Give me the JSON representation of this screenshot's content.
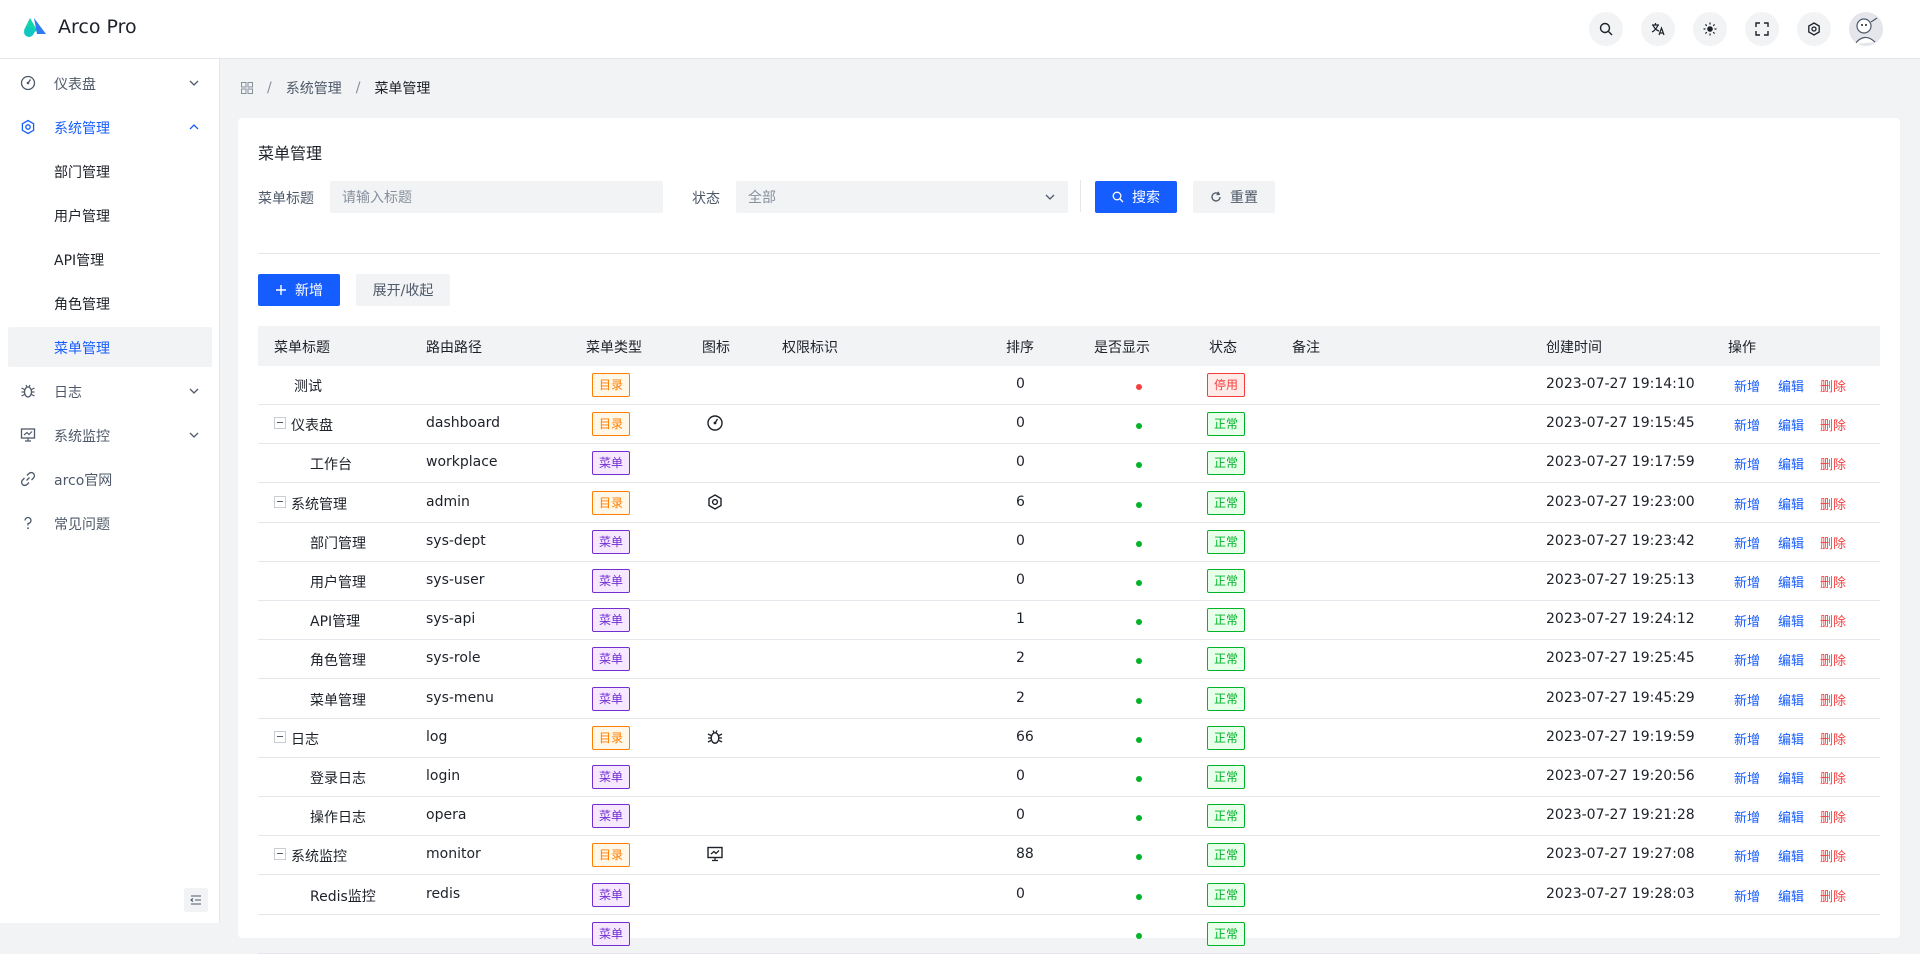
{
  "app": {
    "title": "Arco Pro"
  },
  "navbar": {
    "icons": [
      "search-icon",
      "language-icon",
      "theme-icon",
      "fullscreen-icon",
      "settings-icon",
      "avatar"
    ]
  },
  "sidebar": {
    "items": [
      {
        "label": "仪表盘",
        "icon": "dashboard-icon",
        "arrow": "down"
      },
      {
        "label": "系统管理",
        "icon": "settings-icon",
        "arrow": "up"
      },
      {
        "label": "部门管理"
      },
      {
        "label": "用户管理"
      },
      {
        "label": "API管理"
      },
      {
        "label": "角色管理"
      },
      {
        "label": "菜单管理"
      },
      {
        "label": "日志",
        "icon": "bug-icon",
        "arrow": "down"
      },
      {
        "label": "系统监控",
        "icon": "monitor-icon",
        "arrow": "down"
      },
      {
        "label": "arco官网",
        "icon": "link-icon"
      },
      {
        "label": "常见问题",
        "icon": "question-icon"
      }
    ]
  },
  "breadcrumb": {
    "items": [
      "系统管理",
      "菜单管理"
    ]
  },
  "page": {
    "title": "菜单管理",
    "filters": {
      "title_label": "菜单标题",
      "title_placeholder": "请输入标题",
      "status_label": "状态",
      "status_value": "全部"
    },
    "buttons": {
      "search": "搜索",
      "reset": "重置",
      "add": "新增",
      "expand": "展开/收起"
    }
  },
  "table": {
    "columns": [
      "菜单标题",
      "路由路径",
      "菜单类型",
      "图标",
      "权限标识",
      "排序",
      "是否显示",
      "状态",
      "备注",
      "创建时间",
      "操作"
    ],
    "actions": {
      "add": "新增",
      "edit": "编辑",
      "delete": "删除"
    },
    "rows": [
      {
        "title": "测试",
        "path": "",
        "type": "目录",
        "icon": "",
        "sort": "0",
        "visible": false,
        "status": "停用",
        "created": "2023-07-27 19:14:10",
        "level": 0,
        "expander": false
      },
      {
        "title": "仪表盘",
        "path": "dashboard",
        "type": "目录",
        "icon": "dashboard-icon",
        "sort": "0",
        "visible": true,
        "status": "正常",
        "created": "2023-07-27 19:15:45",
        "level": 0,
        "expander": true
      },
      {
        "title": "工作台",
        "path": "workplace",
        "type": "菜单",
        "icon": "",
        "sort": "0",
        "visible": true,
        "status": "正常",
        "created": "2023-07-27 19:17:59",
        "level": 1,
        "expander": false
      },
      {
        "title": "系统管理",
        "path": "admin",
        "type": "目录",
        "icon": "settings-icon",
        "sort": "6",
        "visible": true,
        "status": "正常",
        "created": "2023-07-27 19:23:00",
        "level": 0,
        "expander": true
      },
      {
        "title": "部门管理",
        "path": "sys-dept",
        "type": "菜单",
        "icon": "",
        "sort": "0",
        "visible": true,
        "status": "正常",
        "created": "2023-07-27 19:23:42",
        "level": 1,
        "expander": false
      },
      {
        "title": "用户管理",
        "path": "sys-user",
        "type": "菜单",
        "icon": "",
        "sort": "0",
        "visible": true,
        "status": "正常",
        "created": "2023-07-27 19:25:13",
        "level": 1,
        "expander": false
      },
      {
        "title": "API管理",
        "path": "sys-api",
        "type": "菜单",
        "icon": "",
        "sort": "1",
        "visible": true,
        "status": "正常",
        "created": "2023-07-27 19:24:12",
        "level": 1,
        "expander": false
      },
      {
        "title": "角色管理",
        "path": "sys-role",
        "type": "菜单",
        "icon": "",
        "sort": "2",
        "visible": true,
        "status": "正常",
        "created": "2023-07-27 19:25:45",
        "level": 1,
        "expander": false
      },
      {
        "title": "菜单管理",
        "path": "sys-menu",
        "type": "菜单",
        "icon": "",
        "sort": "2",
        "visible": true,
        "status": "正常",
        "created": "2023-07-27 19:45:29",
        "level": 1,
        "expander": false
      },
      {
        "title": "日志",
        "path": "log",
        "type": "目录",
        "icon": "bug-icon",
        "sort": "66",
        "visible": true,
        "status": "正常",
        "created": "2023-07-27 19:19:59",
        "level": 0,
        "expander": true
      },
      {
        "title": "登录日志",
        "path": "login",
        "type": "菜单",
        "icon": "",
        "sort": "0",
        "visible": true,
        "status": "正常",
        "created": "2023-07-27 19:20:56",
        "level": 1,
        "expander": false
      },
      {
        "title": "操作日志",
        "path": "opera",
        "type": "菜单",
        "icon": "",
        "sort": "0",
        "visible": true,
        "status": "正常",
        "created": "2023-07-27 19:21:28",
        "level": 1,
        "expander": false
      },
      {
        "title": "系统监控",
        "path": "monitor",
        "type": "目录",
        "icon": "monitor-icon",
        "sort": "88",
        "visible": true,
        "status": "正常",
        "created": "2023-07-27 19:27:08",
        "level": 0,
        "expander": true
      },
      {
        "title": "Redis监控",
        "path": "redis",
        "type": "菜单",
        "icon": "",
        "sort": "0",
        "visible": true,
        "status": "正常",
        "created": "2023-07-27 19:28:03",
        "level": 1,
        "expander": false
      },
      {
        "title": "",
        "path": "",
        "type": "菜单",
        "icon": "",
        "sort": "",
        "visible": true,
        "status": "正常",
        "created": "",
        "level": 1,
        "expander": false
      }
    ]
  },
  "colors": {
    "primary": "#165dff",
    "danger": "#f53f3f",
    "success": "#00b42a",
    "warning": "#ff7d00",
    "purple": "#722ed1"
  }
}
